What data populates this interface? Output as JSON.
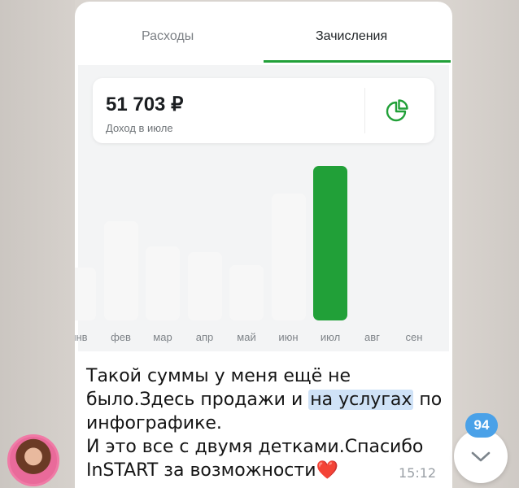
{
  "tabs": [
    {
      "label": "Расходы",
      "active": false
    },
    {
      "label": "Зачисления",
      "active": true
    }
  ],
  "summary": {
    "amount": "51 703 ₽",
    "caption": "Доход в июле",
    "icon": "pie-chart-icon"
  },
  "chart_data": {
    "type": "bar",
    "categories": [
      "янв",
      "фев",
      "мар",
      "апр",
      "май",
      "июн",
      "июл",
      "авг",
      "сен"
    ],
    "values": [
      0.34,
      0.64,
      0.48,
      0.44,
      0.36,
      0.82,
      1.0,
      0,
      0
    ],
    "highlighted": "июл",
    "title": "",
    "xlabel": "",
    "ylabel": ""
  },
  "message": {
    "line1": "Такой суммы у меня ещё не",
    "line2a": "было.Здесь продажи и ",
    "line2b": "на услугах",
    "line2c": " по",
    "line3": "инфографике.",
    "line4": "И это все с двумя детками.Спасибо",
    "line5": "InSTART за возможности",
    "emoji": "❤️",
    "time": "15:12"
  },
  "unread_badge": "94",
  "colors": {
    "accent": "#21a038",
    "bar_inactive": "#f7f7f7",
    "badge": "#4aa1e8",
    "highlight": "#cfe2f7"
  }
}
